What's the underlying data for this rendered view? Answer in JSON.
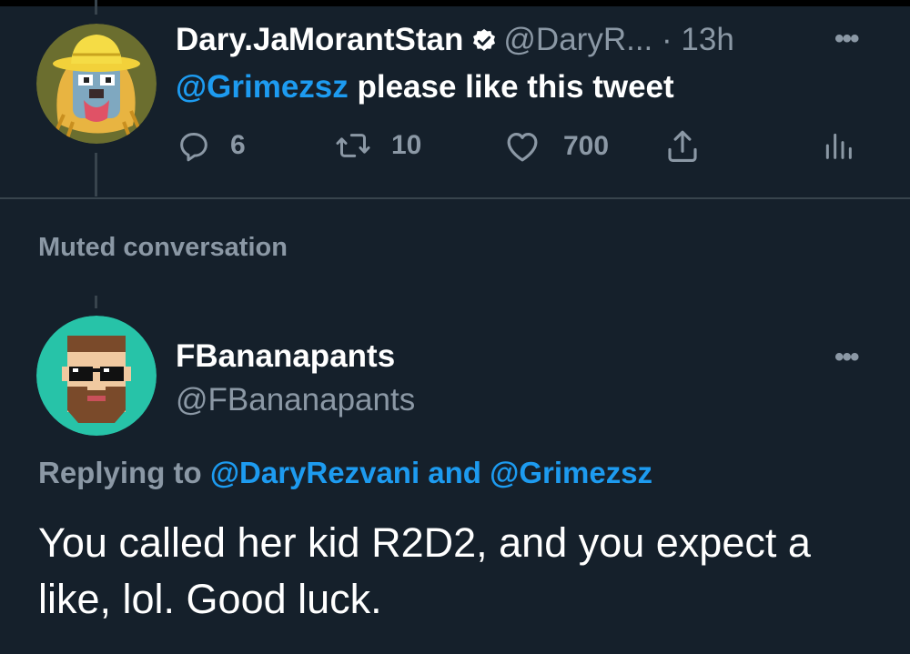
{
  "tweet1": {
    "display_name": "Dary.JaMorantStan",
    "handle": "@DaryR...",
    "separator": "·",
    "time": "13h",
    "text_mention": "@Grimezsz",
    "text_rest": " please like this tweet",
    "actions": {
      "reply_count": "6",
      "retweet_count": "10",
      "like_count": "700"
    },
    "icons": [
      "verified-badge-icon",
      "more-icon",
      "reply-icon",
      "retweet-icon",
      "like-icon",
      "share-icon",
      "analytics-icon"
    ]
  },
  "muted_label": "Muted conversation",
  "tweet2": {
    "display_name": "FBananapants",
    "handle": "@FBananapants",
    "replying_prefix": "Replying to ",
    "replying_mention1": "@DaryRezvani",
    "replying_and": " and ",
    "replying_mention2": "@Grimezsz",
    "text": "You called her kid R2D2, and you expect a like, lol.  Good luck."
  },
  "colors": {
    "background": "#15202b",
    "text_primary": "#ffffff",
    "text_secondary": "#8b98a5",
    "accent": "#1d9bf0",
    "divider": "#38444d"
  }
}
